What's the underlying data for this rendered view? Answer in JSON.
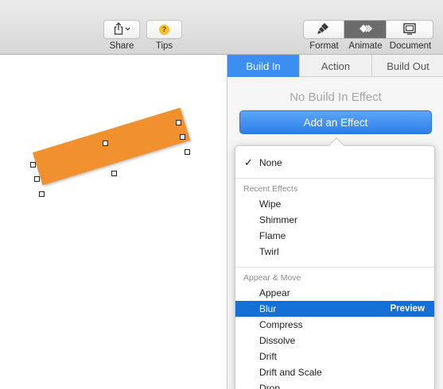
{
  "toolbar": {
    "share_label": "Share",
    "tips_label": "Tips",
    "tips_glyph": "?",
    "format_label": "Format",
    "animate_label": "Animate",
    "document_label": "Document",
    "active_view": "Animate"
  },
  "inspector": {
    "tabs": [
      {
        "label": "Build In",
        "active": true
      },
      {
        "label": "Action",
        "active": false
      },
      {
        "label": "Build Out",
        "active": false
      }
    ],
    "no_effect_text": "No Build In Effect",
    "add_effect_label": "Add an Effect"
  },
  "menu": {
    "none_label": "None",
    "none_checked": true,
    "recent_header": "Recent Effects",
    "recent_items": [
      "Wipe",
      "Shimmer",
      "Flame",
      "Twirl"
    ],
    "appear_header": "Appear & Move",
    "appear_items": [
      "Appear",
      "Blur",
      "Compress",
      "Dissolve",
      "Drift",
      "Drift and Scale",
      "Drop"
    ],
    "selected_item": "Blur",
    "preview_label": "Preview"
  },
  "colors": {
    "accent": "#3b8ff0",
    "selection": "#1470d6",
    "shape_fill": "#f0902e",
    "tips_yellow": "#f6c12a"
  },
  "icons": {
    "share": "share-icon",
    "tips": "question-icon",
    "format": "paintbrush-icon",
    "animate": "diamond-icon",
    "document": "document-icon"
  }
}
